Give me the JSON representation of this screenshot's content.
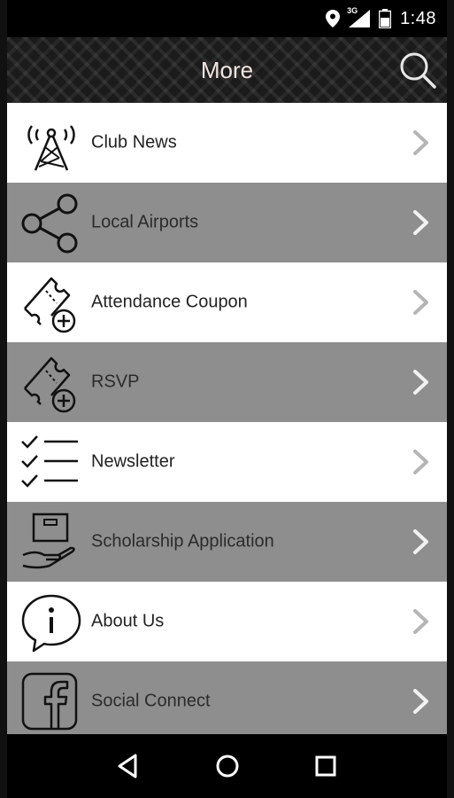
{
  "status_bar": {
    "time": "1:48",
    "network": "3G",
    "icons": [
      "location-icon",
      "signal-icon",
      "battery-icon"
    ]
  },
  "app_bar": {
    "title": "More",
    "search_icon": "search-icon"
  },
  "menu": {
    "items": [
      {
        "label": "Club News",
        "icon": "radio-tower-icon",
        "shaded": false
      },
      {
        "label": "Local Airports",
        "icon": "share-icon",
        "shaded": true
      },
      {
        "label": "Attendance Coupon",
        "icon": "ticket-add-icon",
        "shaded": false
      },
      {
        "label": "RSVP",
        "icon": "ticket-add-icon",
        "shaded": true
      },
      {
        "label": "Newsletter",
        "icon": "checklist-icon",
        "shaded": false
      },
      {
        "label": "Scholarship Application",
        "icon": "hand-box-icon",
        "shaded": true
      },
      {
        "label": "About Us",
        "icon": "info-bubble-icon",
        "shaded": false
      },
      {
        "label": "Social Connect",
        "icon": "facebook-icon",
        "shaded": true
      }
    ]
  },
  "nav_bar": {
    "buttons": [
      "back-icon",
      "home-icon",
      "recents-icon"
    ]
  },
  "colors": {
    "shaded_row": "#8e8e8e",
    "plain_row": "#ffffff",
    "bar_bg": "#000000",
    "title_text": "#f2e6e2"
  }
}
